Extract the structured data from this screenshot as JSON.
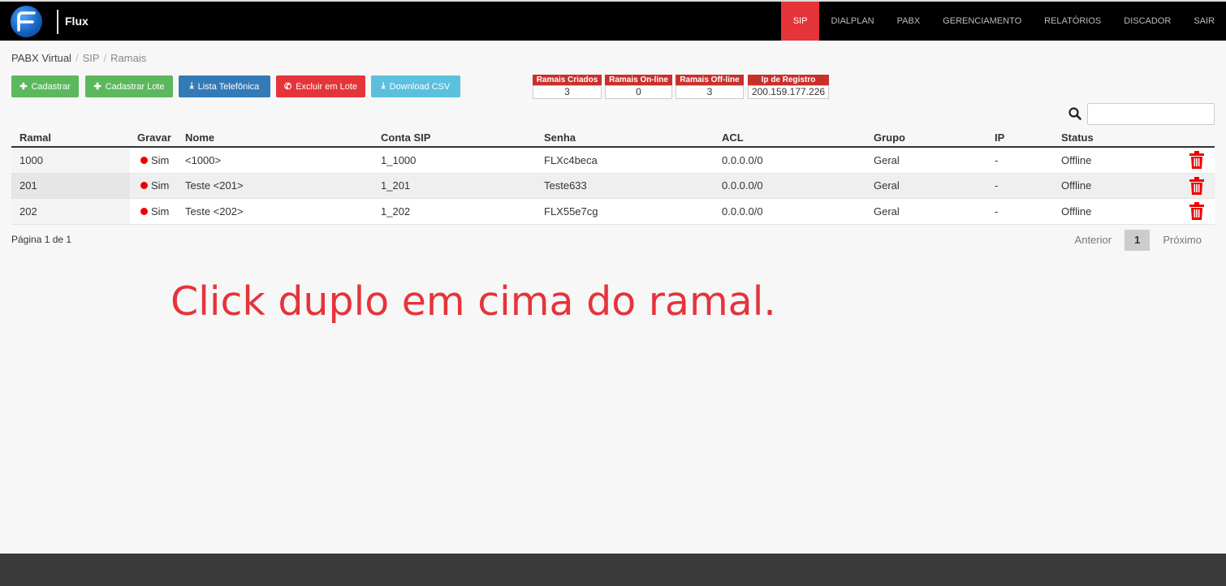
{
  "brand": {
    "name": "Flux"
  },
  "nav": {
    "items": [
      {
        "label": "SIP",
        "active": true
      },
      {
        "label": "DIALPLAN"
      },
      {
        "label": "PABX"
      },
      {
        "label": "GERENCIAMENTO"
      },
      {
        "label": "RELATÓRIOS"
      },
      {
        "label": "DISCADOR"
      },
      {
        "label": "SAIR"
      }
    ]
  },
  "breadcrumb": {
    "root": "PABX Virtual",
    "section": "SIP",
    "current": "Ramais"
  },
  "toolbar": {
    "cadastrar": "Cadastrar",
    "cadastrar_lote": "Cadastrar Lote",
    "lista_telefonica": "Lista Telefônica",
    "excluir_lote": "Excluir em Lote",
    "download_csv": "Download CSV"
  },
  "stats": [
    {
      "label": "Ramais Criados",
      "value": "3"
    },
    {
      "label": "Ramais On-line",
      "value": "0"
    },
    {
      "label": "Ramais Off-line",
      "value": "3"
    },
    {
      "label": "Ip de Registro",
      "value": "200.159.177.226"
    }
  ],
  "search": {
    "placeholder": "",
    "value": ""
  },
  "table": {
    "headers": [
      "Ramal",
      "Gravar",
      "Nome",
      "Conta SIP",
      "Senha",
      "ACL",
      "Grupo",
      "IP",
      "Status"
    ],
    "rows": [
      {
        "ramal": "1000",
        "gravar": "Sim",
        "nome": "<1000>",
        "conta": "1_1000",
        "senha": "FLXc4beca",
        "acl": "0.0.0.0/0",
        "grupo": "Geral",
        "ip": "-",
        "status": "Offline"
      },
      {
        "ramal": "201",
        "gravar": "Sim",
        "nome": "Teste <201>",
        "conta": "1_201",
        "senha": "Teste633",
        "acl": "0.0.0.0/0",
        "grupo": "Geral",
        "ip": "-",
        "status": "Offline"
      },
      {
        "ramal": "202",
        "gravar": "Sim",
        "nome": "Teste <202>",
        "conta": "1_202",
        "senha": "FLX55e7cg",
        "acl": "0.0.0.0/0",
        "grupo": "Geral",
        "ip": "-",
        "status": "Offline"
      }
    ]
  },
  "pagination": {
    "info": "Página 1 de 1",
    "prev": "Anterior",
    "current": "1",
    "next": "Próximo"
  },
  "annotation": "Click duplo em cima do ramal.",
  "colors": {
    "accent_red": "#e5343a",
    "green": "#5cb85c",
    "blue": "#337ab7",
    "cyan": "#5bc0de",
    "stat_header": "#c9302c"
  },
  "icons": {
    "logo": "flux-logo-icon",
    "search": "search-icon",
    "delete": "trash-icon"
  }
}
